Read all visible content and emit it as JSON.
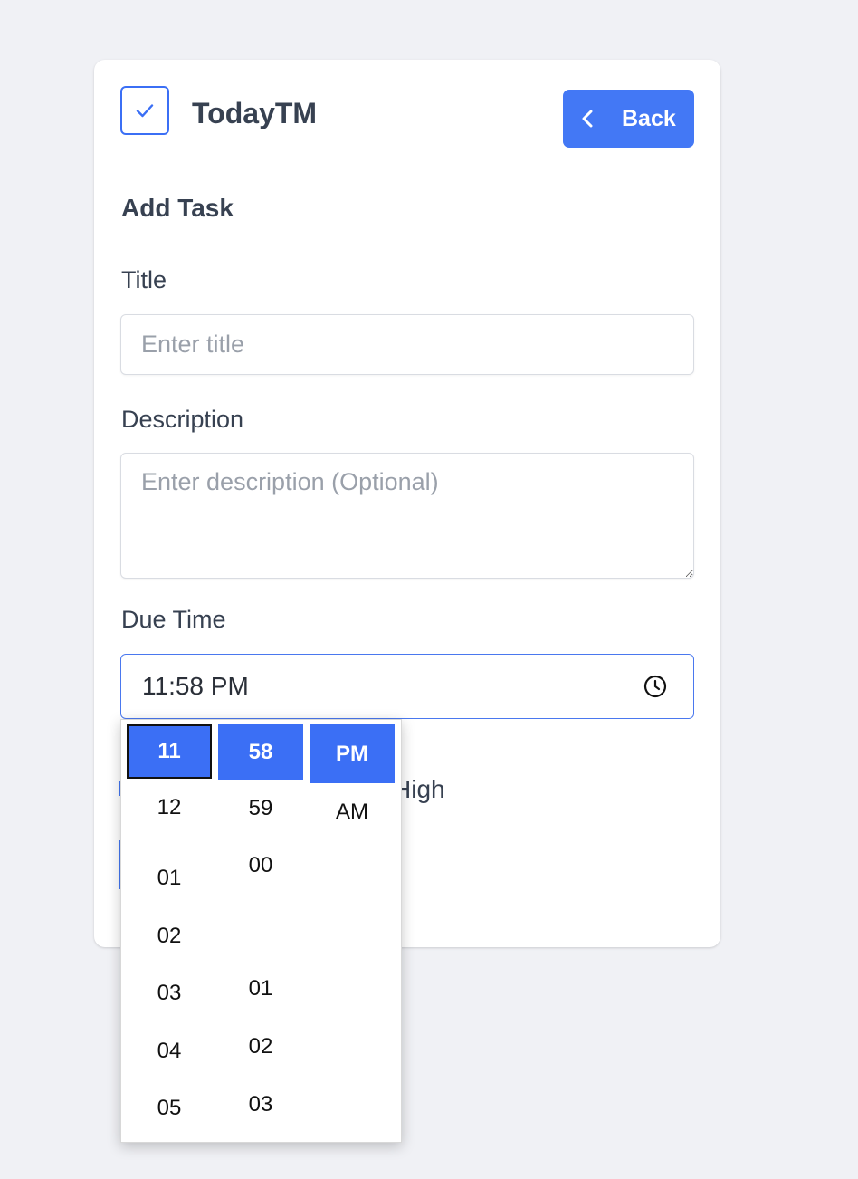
{
  "app": {
    "title": "TodayTM"
  },
  "header": {
    "back_label": "Back"
  },
  "form": {
    "section_title": "Add Task",
    "title_label": "Title",
    "title_placeholder": "Enter title",
    "description_label": "Description",
    "description_placeholder": "Enter description (Optional)",
    "due_time_label": "Due Time",
    "due_time_value": "11:58 PM",
    "priority_partial_text": "High"
  },
  "time_picker": {
    "hours": [
      "11",
      "12",
      "01",
      "02",
      "03",
      "04",
      "05"
    ],
    "minutes": [
      "58",
      "59",
      "00",
      "01",
      "02",
      "03"
    ],
    "periods": [
      "PM",
      "AM"
    ],
    "selected": {
      "hour": "11",
      "minute": "58",
      "period": "PM"
    }
  },
  "colors": {
    "accent": "#4378f5",
    "background": "#f0f1f5",
    "text": "#374151",
    "placeholder": "#9aa0aa"
  }
}
